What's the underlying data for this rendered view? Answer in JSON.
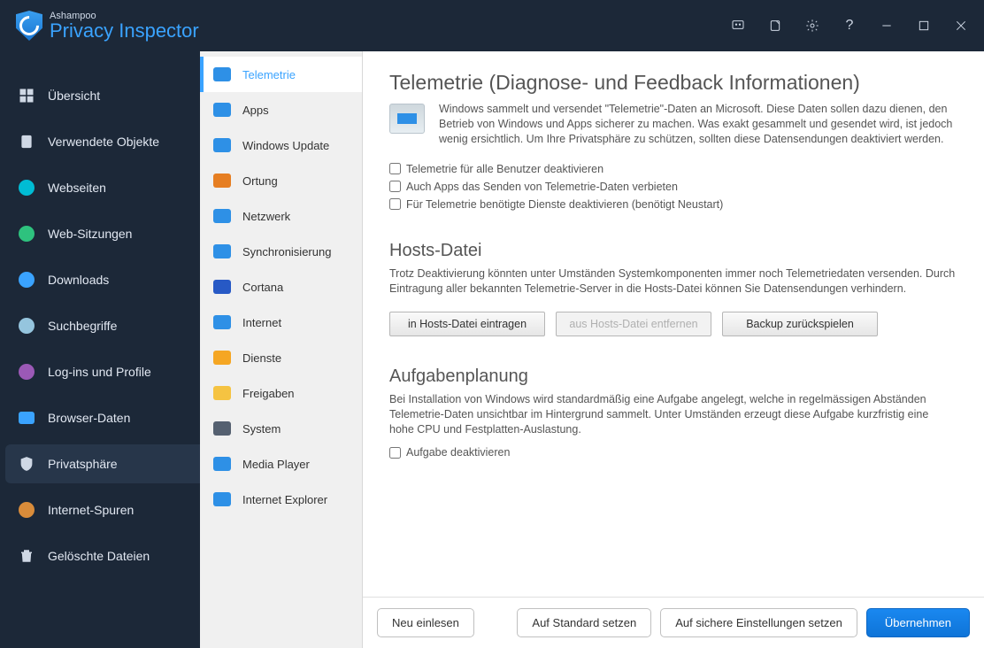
{
  "titlebar": {
    "brand_small": "Ashampoo",
    "brand_main": "Privacy Inspector"
  },
  "nav": {
    "items": [
      {
        "label": "Übersicht",
        "icon": "grid",
        "color": "#3aa3ff"
      },
      {
        "label": "Verwendete Objekte",
        "icon": "file",
        "color": "#3aa3ff"
      },
      {
        "label": "Webseiten",
        "icon": "dot",
        "color": "#00bcd4"
      },
      {
        "label": "Web-Sitzungen",
        "icon": "dot",
        "color": "#2ec27e"
      },
      {
        "label": "Downloads",
        "icon": "dot",
        "color": "#3aa3ff"
      },
      {
        "label": "Suchbegriffe",
        "icon": "dot",
        "color": "#95c5de"
      },
      {
        "label": "Log-ins und Profile",
        "icon": "dot",
        "color": "#9b59b6"
      },
      {
        "label": "Browser-Daten",
        "icon": "sq",
        "color": "#3aa3ff"
      },
      {
        "label": "Privatsphäre",
        "icon": "shield",
        "color": "#3aa3ff",
        "active": true
      },
      {
        "label": "Internet-Spuren",
        "icon": "dot",
        "color": "#d98c3a"
      },
      {
        "label": "Gelöschte Dateien",
        "icon": "trash",
        "color": "#cfd8e5"
      }
    ]
  },
  "subnav": {
    "items": [
      {
        "label": "Telemetrie",
        "color": "#2e90e6",
        "active": true
      },
      {
        "label": "Apps",
        "color": "#2e90e6"
      },
      {
        "label": "Windows Update",
        "color": "#2e90e6"
      },
      {
        "label": "Ortung",
        "color": "#e67e22"
      },
      {
        "label": "Netzwerk",
        "color": "#2e90e6"
      },
      {
        "label": "Synchronisierung",
        "color": "#2e90e6"
      },
      {
        "label": "Cortana",
        "color": "#2759c5"
      },
      {
        "label": "Internet",
        "color": "#2e90e6"
      },
      {
        "label": "Dienste",
        "color": "#f5a623"
      },
      {
        "label": "Freigaben",
        "color": "#f5c342"
      },
      {
        "label": "System",
        "color": "#556070"
      },
      {
        "label": "Media Player",
        "color": "#2e90e6"
      },
      {
        "label": "Internet Explorer",
        "color": "#2e90e6"
      }
    ]
  },
  "content": {
    "title": "Telemetrie (Diagnose- und Feedback Informationen)",
    "intro": "Windows sammelt und versendet \"Telemetrie\"-Daten an Microsoft. Diese Daten sollen dazu dienen, den Betrieb von Windows und Apps sicherer zu machen. Was exakt gesammelt und gesendet wird, ist jedoch wenig ersichtlich. Um Ihre Privatsphäre zu schützen, sollten diese Datensendungen deaktiviert werden.",
    "checks": [
      "Telemetrie für alle Benutzer deaktivieren",
      "Auch Apps das Senden von Telemetrie-Daten verbieten",
      "Für Telemetrie benötigte Dienste deaktivieren (benötigt Neustart)"
    ],
    "hosts_title": "Hosts-Datei",
    "hosts_desc": "Trotz Deaktivierung könnten unter Umständen Systemkomponenten immer noch Telemetriedaten versenden. Durch Eintragung aller bekannten Telemetrie-Server in die Hosts-Datei können Sie Datensendungen verhindern.",
    "hosts_buttons": {
      "add": "in Hosts-Datei eintragen",
      "remove": "aus Hosts-Datei entfernen",
      "backup": "Backup zurückspielen"
    },
    "task_title": "Aufgabenplanung",
    "task_desc": "Bei Installation von Windows wird standardmäßig eine Aufgabe angelegt, welche in regelmässigen Abständen Telemetrie-Daten unsichtbar im Hintergrund sammelt. Unter Umständen erzeugt diese Aufgabe kurzfristig eine hohe CPU und Festplatten-Auslastung.",
    "task_check": "Aufgabe deaktivieren"
  },
  "footer": {
    "reload": "Neu einlesen",
    "default": "Auf Standard setzen",
    "secure": "Auf sichere Einstellungen setzen",
    "apply": "Übernehmen"
  }
}
